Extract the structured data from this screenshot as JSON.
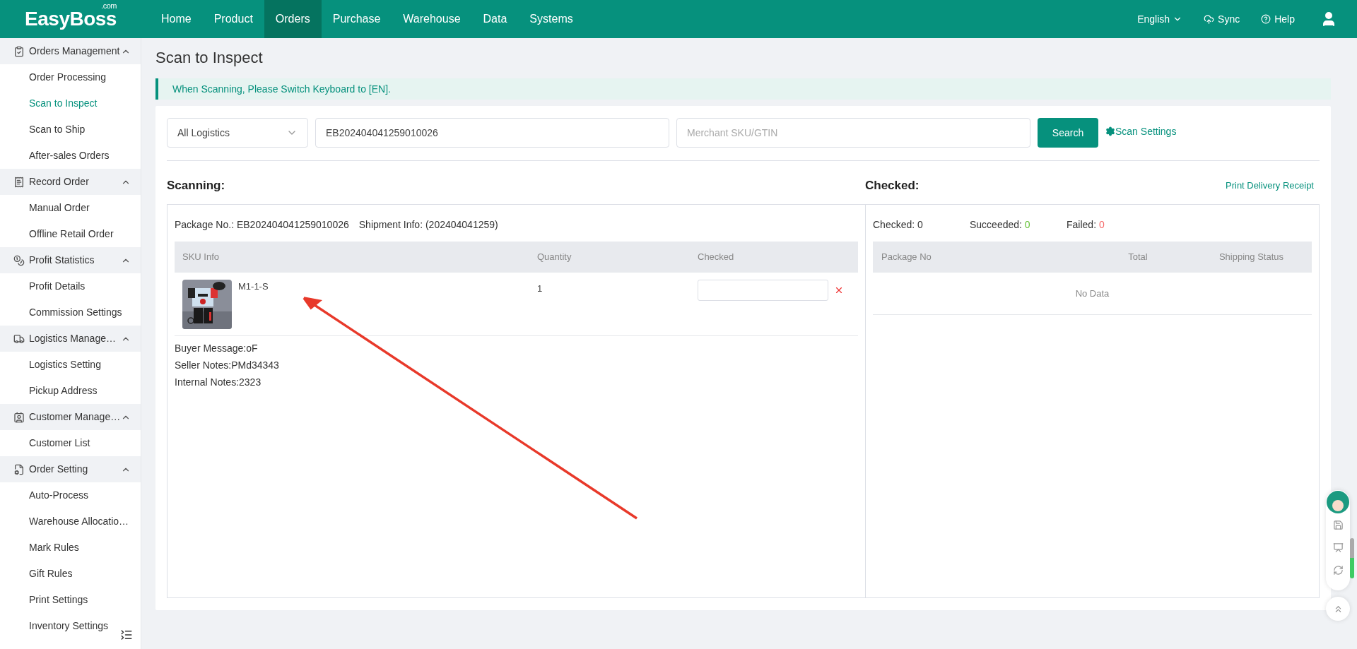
{
  "header": {
    "logo": "EasyBoss",
    "logo_suffix": ".com",
    "nav": [
      {
        "label": "Home",
        "selected": false
      },
      {
        "label": "Product",
        "selected": false
      },
      {
        "label": "Orders",
        "selected": true
      },
      {
        "label": "Purchase",
        "selected": false
      },
      {
        "label": "Warehouse",
        "selected": false
      },
      {
        "label": "Data",
        "selected": false
      },
      {
        "label": "Systems",
        "selected": false
      }
    ],
    "language": "English",
    "sync": "Sync",
    "help": "Help"
  },
  "sidebar": {
    "groups": [
      {
        "title": "Orders Management",
        "expanded": true,
        "items": [
          {
            "label": "Order Processing",
            "selected": false
          },
          {
            "label": "Scan to Inspect",
            "selected": true
          },
          {
            "label": "Scan to Ship",
            "selected": false
          },
          {
            "label": "After-sales Orders",
            "selected": false
          }
        ]
      },
      {
        "title": "Record Order",
        "expanded": true,
        "items": [
          {
            "label": "Manual Order",
            "selected": false
          },
          {
            "label": "Offline Retail Order",
            "selected": false
          }
        ]
      },
      {
        "title": "Profit Statistics",
        "expanded": true,
        "items": [
          {
            "label": "Profit Details",
            "selected": false
          },
          {
            "label": "Commission Settings",
            "selected": false
          }
        ]
      },
      {
        "title": "Logistics Manage…",
        "expanded": true,
        "items": [
          {
            "label": "Logistics Setting",
            "selected": false
          },
          {
            "label": "Pickup Address",
            "selected": false
          }
        ]
      },
      {
        "title": "Customer Manage…",
        "expanded": true,
        "items": [
          {
            "label": "Customer List",
            "selected": false
          }
        ]
      },
      {
        "title": "Order Setting",
        "expanded": true,
        "items": [
          {
            "label": "Auto-Process",
            "selected": false
          },
          {
            "label": "Warehouse Allocatio…",
            "selected": false
          },
          {
            "label": "Mark Rules",
            "selected": false
          },
          {
            "label": "Gift Rules",
            "selected": false
          },
          {
            "label": "Print Settings",
            "selected": false
          },
          {
            "label": "Inventory Settings",
            "selected": false
          }
        ]
      }
    ]
  },
  "page_title": "Scan to Inspect",
  "notice": "When Scanning, Please Switch Keyboard to [EN].",
  "filters": {
    "logistics_select": "All Logistics",
    "package_field": "EB202404041259010026",
    "sku_field_placeholder": "Merchant SKU/GTIN",
    "search_button": "Search",
    "scan_settings": "Scan Settings"
  },
  "scanning": {
    "title": "Scanning:",
    "package_no": "Package No.: EB202404041259010026",
    "shipment_info": "Shipment Info: (202404041259)",
    "columns": [
      "SKU Info",
      "Quantity",
      "Checked"
    ],
    "rows": [
      {
        "sku": "M1-1-S",
        "quantity": "1"
      }
    ],
    "notes": [
      "Buyer Message:oF",
      "Seller Notes:PMd34343",
      "Internal Notes:2323"
    ]
  },
  "checked": {
    "title": "Checked:",
    "print_link": "Print Delivery Receipt",
    "stats": [
      {
        "label": "Checked:",
        "value": "0",
        "color": "#333333"
      },
      {
        "label": "Succeeded:",
        "value": "0",
        "color": "#67c23a"
      },
      {
        "label": "Failed:",
        "value": "0",
        "color": "#f56c6c"
      }
    ],
    "columns": [
      "Package No",
      "Total",
      "Shipping Status"
    ],
    "empty_text": "No Data"
  }
}
